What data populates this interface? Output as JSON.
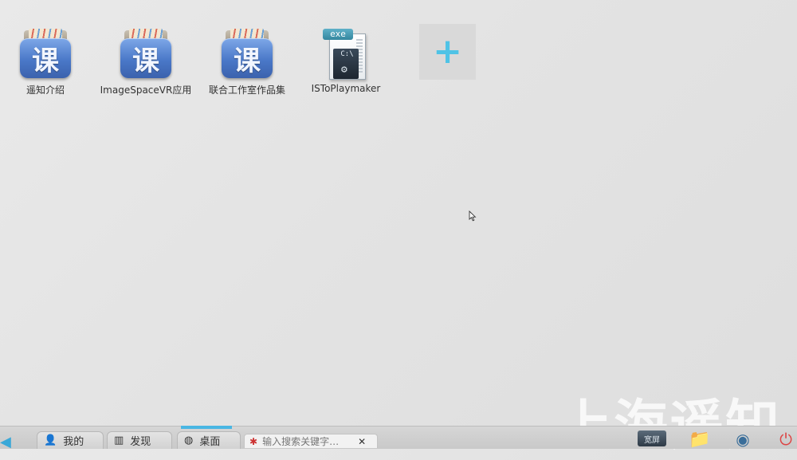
{
  "desktop": {
    "icons": [
      {
        "label": "遥知介绍",
        "glyph": "课",
        "type": "course-folder-icon"
      },
      {
        "label": "ImageSpaceVR应用",
        "glyph": "课",
        "type": "course-folder-icon"
      },
      {
        "label": "联合工作室作品集",
        "glyph": "课",
        "type": "course-folder-icon"
      },
      {
        "label": "ISToPlaymaker",
        "tag": "exe",
        "prompt": "C:\\",
        "type": "exe-file-icon"
      }
    ],
    "add_tile_symbol": "+",
    "watermark": "上海遥知"
  },
  "taskbar": {
    "back_symbol": "◀",
    "tabs": [
      {
        "label": "我的",
        "icon": "user-icon"
      },
      {
        "label": "发现",
        "icon": "book-icon"
      },
      {
        "label": "桌面",
        "icon": "desktop-globe-icon"
      }
    ],
    "active_tab": "桌面",
    "search": {
      "placeholder": "输入搜索关键字…",
      "close": "✕"
    },
    "tray": {
      "screen_label": "宽屏"
    }
  },
  "colors": {
    "accent": "#49b6e3",
    "folder_blue": "#4a78c8",
    "add_plus": "#4fc3e6"
  }
}
